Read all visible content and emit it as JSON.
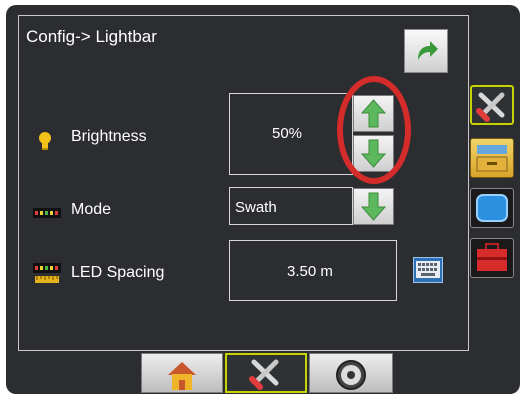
{
  "header": {
    "title": "Config-> Lightbar",
    "back_icon": "back-arrow-icon"
  },
  "rows": {
    "brightness": {
      "label": "Brightness",
      "value": "50%",
      "icon": "bulb-icon"
    },
    "mode": {
      "label": "Mode",
      "value": "Swath",
      "icon": "lightbar-icon"
    },
    "led_spacing": {
      "label": "LED Spacing",
      "value": "3.50 m",
      "icon": "led-spacing-icon"
    }
  },
  "side_tabs": [
    "tools-tab-icon",
    "console-tab-icon",
    "display-tab-icon",
    "toolbox-tab-icon"
  ],
  "bottom_tabs": [
    "home-tab-icon",
    "tools-tab-icon",
    "gauge-tab-icon"
  ],
  "colors": {
    "accent_green": "#5cb85c",
    "highlight": "#d42b2b",
    "active_border": "#c7d300"
  }
}
